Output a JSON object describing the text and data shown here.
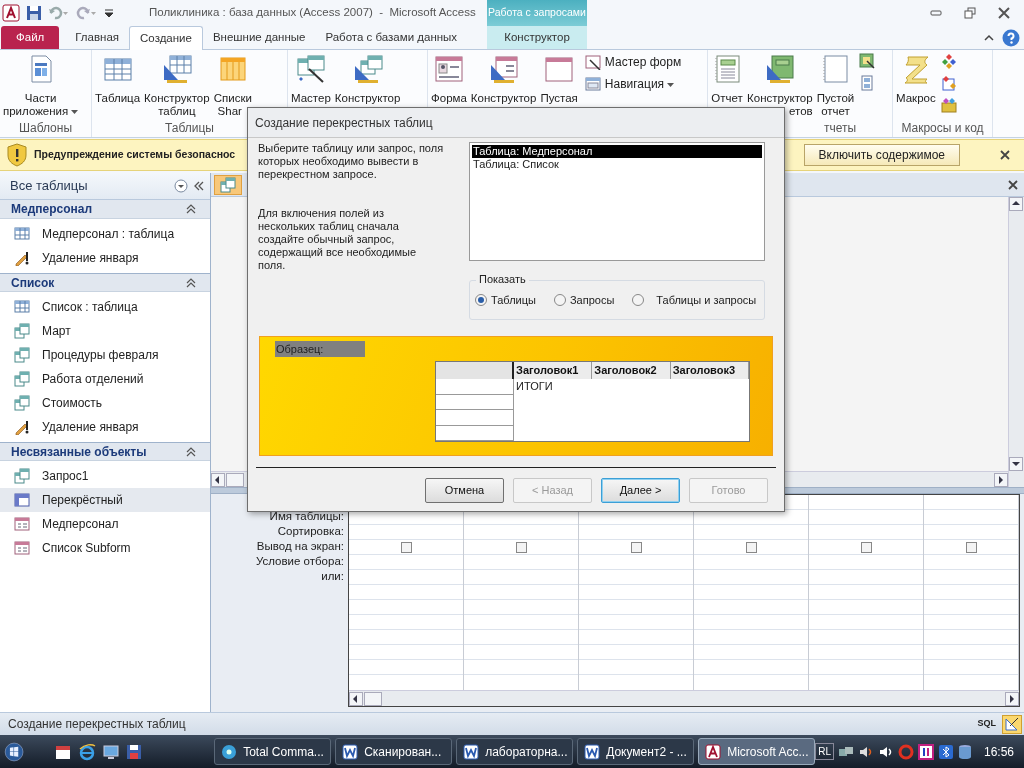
{
  "title_bar": {
    "title": "Поликлиника : база данных (Access 2007)  -  Microsoft Access",
    "context_group": "Работа с запросами"
  },
  "ribbon_tabs": [
    {
      "label": "Файл",
      "kind": "file",
      "selected": false
    },
    {
      "label": "Главная",
      "kind": "tab",
      "selected": false
    },
    {
      "label": "Создание",
      "kind": "tab",
      "selected": true
    },
    {
      "label": "Внешние данные",
      "kind": "tab",
      "selected": false
    },
    {
      "label": "Работа с базами данных",
      "kind": "tab",
      "selected": false
    },
    {
      "label": "Конструктор",
      "kind": "context",
      "selected": false
    }
  ],
  "ribbon_groups": [
    {
      "label": "Шаблоны",
      "buttons": [
        {
          "kind": "app-parts",
          "lines": [
            "Части",
            "приложения"
          ],
          "dropdown": true
        }
      ]
    },
    {
      "label": "Таблицы",
      "buttons": [
        {
          "kind": "table",
          "lines": [
            "Таблица"
          ],
          "dropdown": false
        },
        {
          "kind": "table-design",
          "lines": [
            "Конструктор",
            "таблиц"
          ],
          "dropdown": false
        },
        {
          "kind": "list",
          "lines": [
            "Списки",
            "Shar"
          ],
          "dropdown": false
        }
      ]
    },
    {
      "buttons": [
        {
          "kind": "wizard",
          "lines": [
            "Мастер"
          ],
          "dropdown": false
        },
        {
          "kind": "query-design",
          "lines": [
            "Конструктор"
          ],
          "dropdown": false
        }
      ]
    },
    {
      "buttons": [
        {
          "kind": "form",
          "lines": [
            "Форма"
          ],
          "dropdown": false
        },
        {
          "kind": "form-design",
          "lines": [
            "Конструктор"
          ],
          "dropdown": false
        },
        {
          "kind": "blank-form",
          "lines": [
            "Пустая"
          ],
          "dropdown": false
        }
      ],
      "small": [
        {
          "kind": "form-wizard",
          "label": "Мастер форм",
          "dropdown": false
        },
        {
          "kind": "navigation",
          "label": "Навигация",
          "dropdown": true
        }
      ]
    },
    {
      "label": "тчеты",
      "buttons": [
        {
          "kind": "report",
          "lines": [
            "Отчет"
          ],
          "dropdown": false
        },
        {
          "kind": "report-design",
          "lines": [
            "Конструктор",
            "етов"
          ],
          "dropdown": false
        },
        {
          "kind": "blank-report",
          "lines": [
            "Пустой",
            "отчет"
          ],
          "dropdown": false
        }
      ],
      "small": [
        {
          "kind": "report-wizard"
        },
        {
          "kind": "labels"
        }
      ]
    },
    {
      "label": "Макросы и код",
      "buttons": [
        {
          "kind": "macro",
          "lines": [
            "Макрос"
          ],
          "dropdown": false
        }
      ],
      "small": [
        {
          "kind": "module"
        },
        {
          "kind": "class-module"
        },
        {
          "kind": "vba"
        }
      ]
    }
  ],
  "warning": {
    "message": "Предупреждение системы безопаснос",
    "button": "Включить содержимое"
  },
  "nav_pane": {
    "title": "Все таблицы",
    "groups": [
      {
        "label": "Медперсонал",
        "expanded": true,
        "items": [
          {
            "label": "Медперсонал : таблица",
            "kind": "table",
            "selected": false
          },
          {
            "label": "Удаление января",
            "kind": "delete-query",
            "selected": false
          }
        ]
      },
      {
        "label": "Список",
        "expanded": true,
        "items": [
          {
            "label": "Список : таблица",
            "kind": "table",
            "selected": false
          },
          {
            "label": "Март",
            "kind": "select-query",
            "selected": false
          },
          {
            "label": "Процедуры февраля",
            "kind": "select-query",
            "selected": false
          },
          {
            "label": "Работа отделений",
            "kind": "select-query",
            "selected": false
          },
          {
            "label": "Стоимость",
            "kind": "select-query",
            "selected": false
          },
          {
            "label": "Удаление января",
            "kind": "delete-query",
            "selected": false
          }
        ]
      },
      {
        "label": "Несвязанные объекты",
        "expanded": true,
        "items": [
          {
            "label": "Запрос1",
            "kind": "select-query",
            "selected": false
          },
          {
            "label": "Перекрёстный",
            "kind": "crosstab",
            "selected": true
          },
          {
            "label": "Медперсонал",
            "kind": "form",
            "selected": false
          },
          {
            "label": "Список Subform",
            "kind": "form",
            "selected": false
          }
        ]
      }
    ]
  },
  "query_grid": {
    "rows": [
      {
        "label": "Имя таблицы:",
        "kind": "text"
      },
      {
        "label": "Сортировка:",
        "kind": "text"
      },
      {
        "label": "Вывод на экран:",
        "kind": "checkbox"
      },
      {
        "label": "Условие отбора:",
        "kind": "text"
      },
      {
        "label": "или:",
        "kind": "text"
      }
    ],
    "columns": [
      {
        "show": false
      },
      {
        "show": false
      },
      {
        "show": false
      },
      {
        "show": false
      },
      {
        "show": false
      },
      {
        "show": false
      }
    ]
  },
  "dialog": {
    "title": "Создание перекрестных таблиц",
    "instructions": [
      "Выберите таблицу или запрос, поля которых необходимо вывести в перекрестном запросе.",
      "Для включения полей из нескольких таблиц сначала создайте обычный запрос, содержащий все необходимые поля."
    ],
    "sources": [
      {
        "label": "Таблица: Медперсонал",
        "selected": true
      },
      {
        "label": "Таблица: Список",
        "selected": false
      }
    ],
    "show_group": {
      "label": "Показать",
      "options": [
        {
          "label": "Таблицы",
          "selected": true
        },
        {
          "label": "Запросы",
          "selected": false
        },
        {
          "label": "Таблицы и запросы",
          "selected": false
        }
      ]
    },
    "sample": {
      "label": "Образец:",
      "headers": [
        "Заголовок1",
        "Заголовок2",
        "Заголовок3"
      ],
      "total": "ИТОГИ"
    },
    "buttons": [
      {
        "label": "Отмена",
        "disabled": false,
        "default": false
      },
      {
        "label": "< Назад",
        "disabled": true,
        "default": false
      },
      {
        "label": "Далее >",
        "disabled": false,
        "default": true
      },
      {
        "label": "Готово",
        "disabled": true,
        "default": false
      }
    ]
  },
  "status_bar": {
    "text": "Создание перекрестных таблиц",
    "views": [
      {
        "kind": "sql",
        "label": "SQL",
        "selected": false
      },
      {
        "kind": "design",
        "selected": true
      }
    ]
  },
  "taskbar": {
    "windows": [
      {
        "label": "Total Comma...",
        "kind": "commander",
        "selected": false
      },
      {
        "label": "Сканирован...",
        "kind": "word",
        "selected": false
      },
      {
        "label": "лабораторна...",
        "kind": "word",
        "selected": false
      },
      {
        "label": "Документ2 - ...",
        "kind": "word",
        "selected": false
      },
      {
        "label": "Microsoft Acc...",
        "kind": "access",
        "selected": true
      }
    ],
    "language": "RL",
    "clock": "16:56"
  }
}
